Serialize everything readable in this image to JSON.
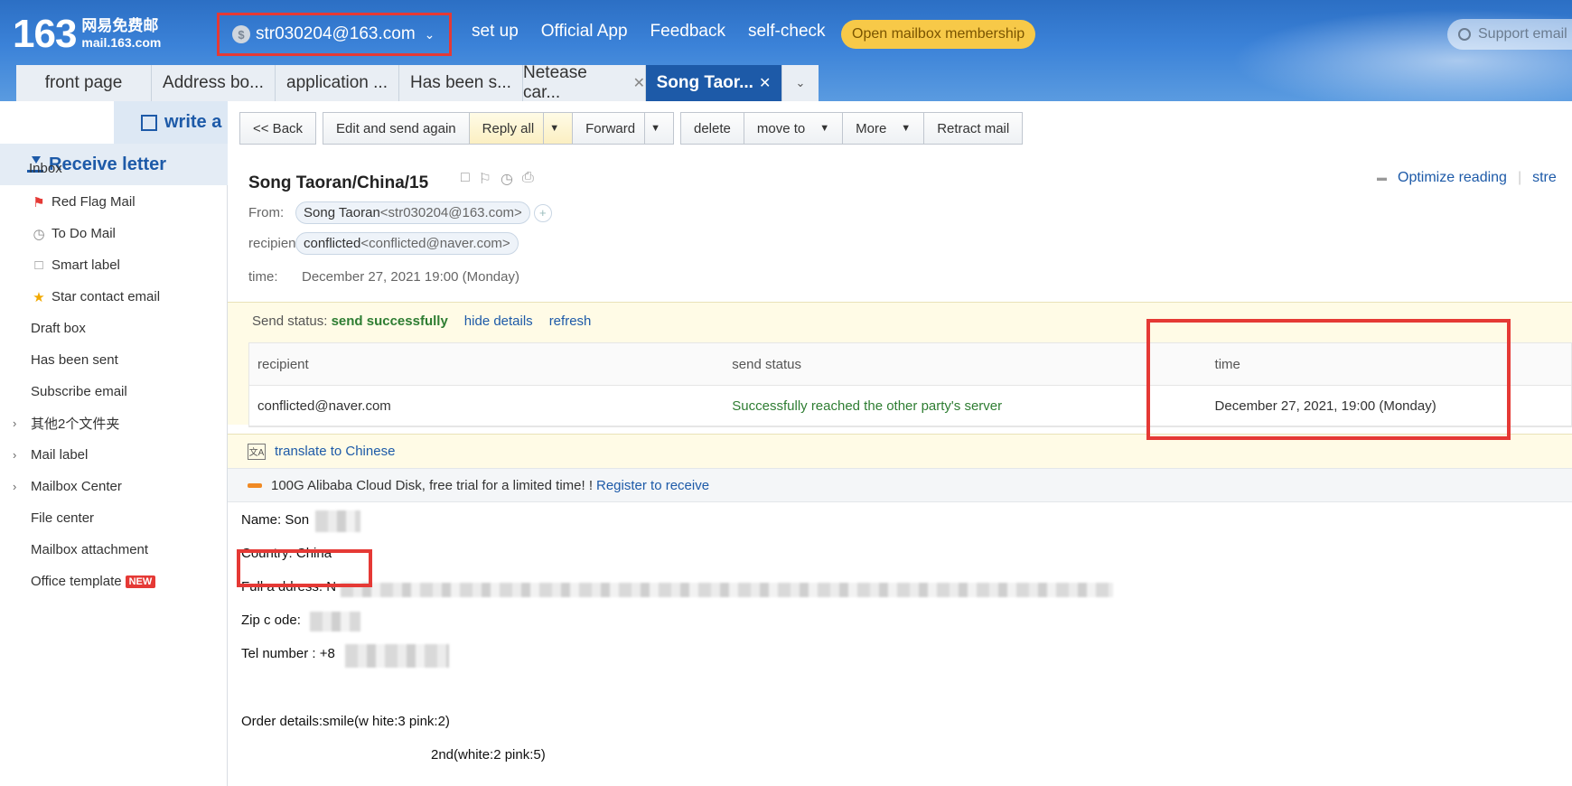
{
  "header": {
    "logo_num": "163",
    "logo_cn": "网易免费邮",
    "logo_url": "mail.163.com",
    "account": "str030204@163.com",
    "nav": [
      "set up",
      "Official App",
      "Feedback",
      "self-check"
    ],
    "membership": "Open mailbox membership",
    "support_placeholder": "Support email"
  },
  "tabs": [
    {
      "label": "front page"
    },
    {
      "label": "Address bo..."
    },
    {
      "label": "application ..."
    },
    {
      "label": "Has been s..."
    },
    {
      "label": "Netease car..."
    },
    {
      "label": "Song Taor..."
    }
  ],
  "sidebar": {
    "write": "write a",
    "receive": "Receive letter",
    "inbox": "Inbox",
    "items": [
      {
        "label": "Red Flag Mail"
      },
      {
        "label": "To Do Mail"
      },
      {
        "label": "Smart label"
      },
      {
        "label": "Star contact email"
      },
      {
        "label": "Draft box"
      },
      {
        "label": "Has been sent"
      },
      {
        "label": "Subscribe email"
      },
      {
        "label": "其他2个文件夹"
      },
      {
        "label": "Mail label"
      },
      {
        "label": "Mailbox Center"
      },
      {
        "label": "File center"
      },
      {
        "label": "Mailbox attachment"
      },
      {
        "label": "Office template"
      }
    ],
    "new_badge": "NEW"
  },
  "toolbar": {
    "back": "<< Back",
    "edit_send": "Edit and send again",
    "reply_all": "Reply all",
    "forward": "Forward",
    "delete": "delete",
    "move_to": "move to",
    "more": "More",
    "retract": "Retract mail"
  },
  "mail": {
    "subject": "Song Taoran/China/15",
    "optimize": "Optimize reading",
    "stre": "stre",
    "from_label": "From:",
    "from_name": "Song Taoran",
    "from_addr": "<str030204@163.com>",
    "recipient_label": "recipient:",
    "recipient_name": "conflicted",
    "recipient_addr": "<conflicted@naver.com>",
    "time_label": "time:",
    "time_value": "December 27, 2021 19:00 (Monday)"
  },
  "status": {
    "label": "Send status:",
    "value": "send successfully",
    "hide": "hide details",
    "refresh": "refresh",
    "headers": [
      "recipient",
      "send status",
      "time"
    ],
    "rows": [
      {
        "recipient": "conflicted@naver.com",
        "status": "Successfully reached the other party's server",
        "time": "December 27, 2021, 19:00 (Monday)"
      }
    ]
  },
  "translate": "translate to Chinese",
  "ad": {
    "text": "100G Alibaba Cloud Disk, free trial for a limited time! !",
    "link": "Register to receive"
  },
  "body": {
    "name": "Name: Son",
    "country": "Country: China",
    "address": "Full a ddress: N",
    "zip": "Zip c ode:",
    "tel": "Tel number : +8",
    "order1": "Order details:smile(w hite:3 pink:2)",
    "order2": "2nd(white:2 pink:5)"
  },
  "colors": {
    "accent": "#1d5aa8",
    "highlight": "#e53935",
    "success": "#2e7d32",
    "membership": "#f7c948"
  }
}
